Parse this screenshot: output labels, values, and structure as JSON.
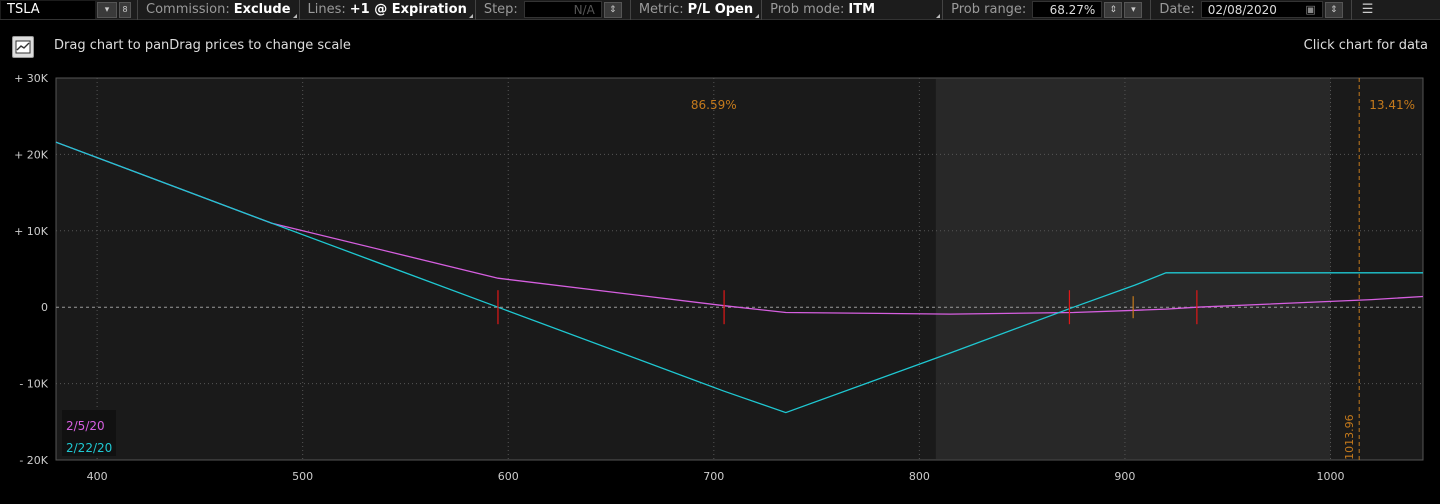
{
  "toolbar": {
    "symbol": "TSLA",
    "commission_label": "Commission:",
    "commission_value": "Exclude",
    "lines_label": "Lines:",
    "lines_value": "+1 @ Expiration",
    "step_label": "Step:",
    "step_value": "N/A",
    "metric_label": "Metric:",
    "metric_value": "P/L Open",
    "prob_mode_label": "Prob mode:",
    "prob_mode_value": "ITM",
    "prob_range_label": "Prob range:",
    "prob_range_value": "68.27%",
    "date_label": "Date:",
    "date_value": "02/08/2020"
  },
  "hints": {
    "left": "Drag chart to panDrag prices to change scale",
    "right": "Click chart for data"
  },
  "colors": {
    "series_2_5_20": "#d65fe0",
    "series_2_22_20": "#1fc8d2",
    "probability_text": "#c57a1c",
    "strike_marker": "#e01818",
    "background": "#1a1a1a",
    "probability_band": "#282828"
  },
  "chart_data": {
    "type": "line",
    "x": [
      380,
      485,
      595,
      705,
      735,
      815,
      875,
      905,
      920,
      935,
      1020,
      1045
    ],
    "xlim": [
      380,
      1045
    ],
    "ylim": [
      -20000,
      30000
    ],
    "x_ticks": [
      400,
      500,
      600,
      700,
      800,
      900,
      1000
    ],
    "x_tick_labels": [
      "400",
      "500",
      "600",
      "700",
      "800",
      "900",
      "1000"
    ],
    "y_ticks": [
      30000,
      20000,
      10000,
      0,
      -10000,
      -20000
    ],
    "y_tick_labels": [
      "+ 30K",
      "+ 20K",
      "+ 10K",
      "0",
      "- 10K",
      "- 20K"
    ],
    "grid": true,
    "series": [
      {
        "name": "2/5/20",
        "color": "#d65fe0",
        "values": [
          21600,
          11000,
          3800,
          200,
          -700,
          -900,
          -700,
          -400,
          -250,
          0,
          1000,
          1400
        ]
      },
      {
        "name": "2/22/20",
        "color": "#1fc8d2",
        "values": [
          21600,
          11000,
          0,
          -11000,
          -13800,
          -6000,
          0,
          2900,
          4500,
          4500,
          4500,
          4500
        ]
      }
    ],
    "strike_markers": [
      595,
      705,
      873,
      935
    ],
    "price_marker": 904,
    "probability_band": [
      808,
      1000
    ],
    "current_price_line": 1013.96,
    "current_price_label": "1013.96",
    "probability_labels": [
      {
        "text": "86.59%",
        "x": 700
      },
      {
        "text": "13.41%",
        "x": 1030
      }
    ],
    "legend": [
      "2/5/20",
      "2/22/20"
    ],
    "legend_position": "bottom-left"
  }
}
